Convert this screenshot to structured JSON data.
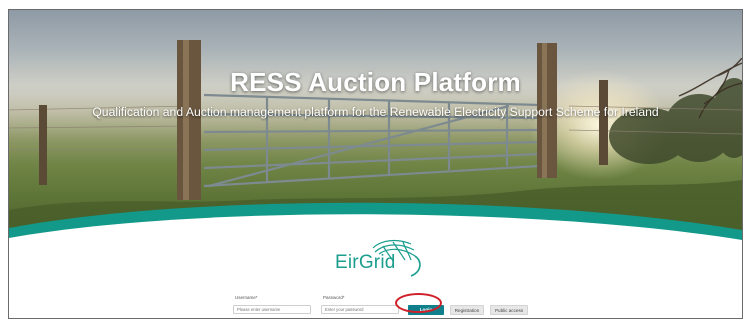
{
  "hero": {
    "title": "RESS Auction Platform",
    "subtitle": "Qualification and Auction management platform for the Renewable Electricity Support Scheme for Ireland"
  },
  "logo": {
    "text": "EirGrid"
  },
  "login_form": {
    "username_label": "Username*",
    "username_placeholder": "Please enter username",
    "password_label": "Password*",
    "password_placeholder": "Enter your password",
    "login_button": "Login",
    "registration_button": "Registration",
    "public_access_button": "Public access"
  },
  "colors": {
    "brand_teal": "#1b9e8e",
    "login_button": "#0e7f8b",
    "highlight_ring": "#d0202a"
  }
}
